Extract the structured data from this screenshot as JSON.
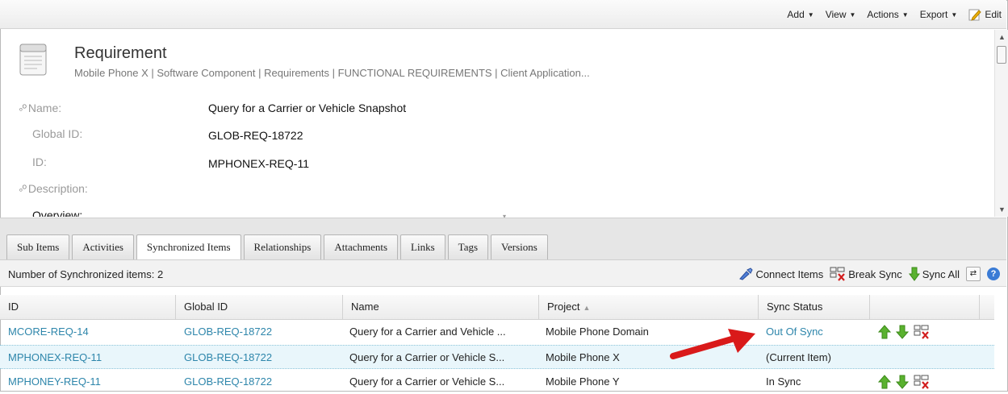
{
  "toolbar": {
    "add": "Add",
    "view": "View",
    "actions": "Actions",
    "export": "Export",
    "edit": "Edit"
  },
  "item": {
    "type": "Requirement",
    "breadcrumb": "Mobile Phone X | Software Component | Requirements | FUNCTIONAL REQUIREMENTS | Client Application..."
  },
  "fields": {
    "name_label": "Name:",
    "name_value": "Query for a Carrier or Vehicle Snapshot",
    "global_id_label": "Global ID:",
    "global_id_value": "GLOB-REQ-18722",
    "id_label": "ID:",
    "id_value": "MPHONEX-REQ-11",
    "description_label": "Description:",
    "description_heading": "Overview:"
  },
  "tabs": [
    {
      "label": "Sub Items"
    },
    {
      "label": "Activities"
    },
    {
      "label": "Synchronized Items"
    },
    {
      "label": "Relationships"
    },
    {
      "label": "Attachments"
    },
    {
      "label": "Links"
    },
    {
      "label": "Tags"
    },
    {
      "label": "Versions"
    }
  ],
  "active_tab": "Synchronized Items",
  "sync": {
    "count_text": "Number of Synchronized items: 2",
    "connect_label": "Connect Items",
    "break_label": "Break Sync",
    "sync_all_label": "Sync All"
  },
  "table": {
    "columns": [
      "ID",
      "Global ID",
      "Name",
      "Project",
      "Sync Status"
    ],
    "rows": [
      {
        "id": "MCORE-REQ-14",
        "global_id": "GLOB-REQ-18722",
        "name": "Query for a Carrier and Vehicle ...",
        "project": "Mobile Phone Domain",
        "status": "Out Of Sync"
      },
      {
        "id": "MPHONEX-REQ-11",
        "global_id": "GLOB-REQ-18722",
        "name": "Query for a Carrier or Vehicle S...",
        "project": "Mobile Phone X",
        "status": "(Current Item)"
      },
      {
        "id": "MPHONEY-REQ-11",
        "global_id": "GLOB-REQ-18722",
        "name": "Query for a Carrier or Vehicle S...",
        "project": "Mobile Phone Y",
        "status": "In Sync"
      }
    ]
  },
  "colors": {
    "link": "#2e86ab",
    "current_row": "#e9f6fb",
    "annotation_arrow": "#d91a1a",
    "up_arrow": "#5ab22f",
    "down_arrow": "#5ab22f"
  }
}
